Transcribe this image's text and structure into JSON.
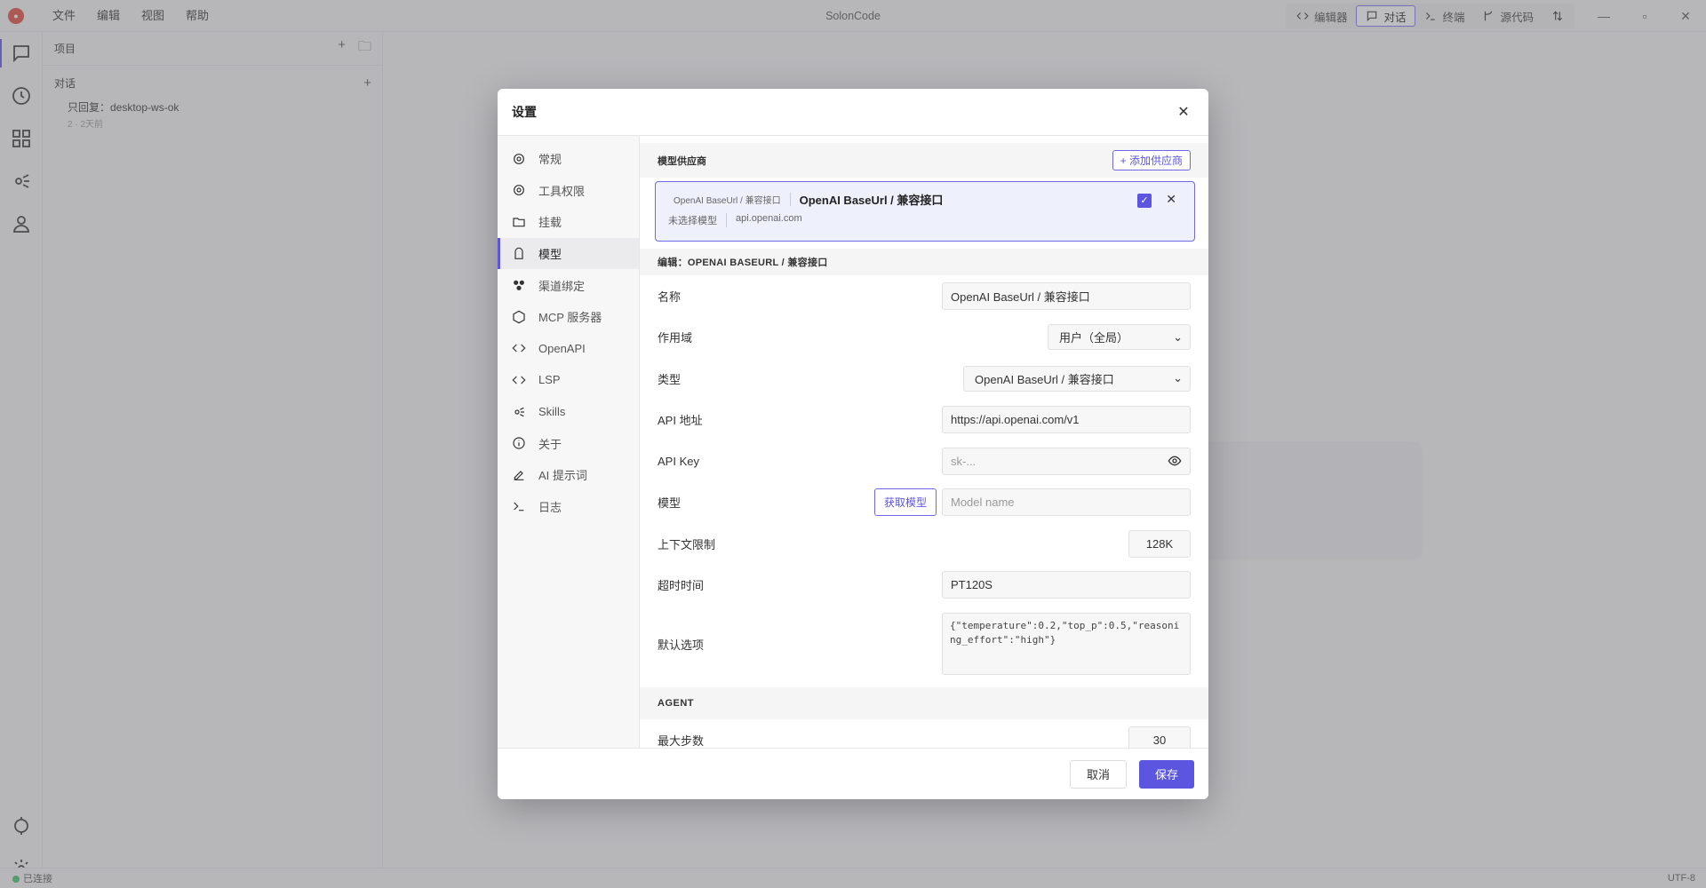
{
  "app": {
    "title": "SolonCode",
    "menu": [
      "文件",
      "编辑",
      "视图",
      "帮助"
    ],
    "mode_tabs": [
      {
        "label": "编辑器",
        "icon": "code-icon"
      },
      {
        "label": "对话",
        "icon": "chat-icon",
        "active": true
      },
      {
        "label": "终端",
        "icon": "terminal-icon"
      },
      {
        "label": "源代码",
        "icon": "git-branch-icon"
      }
    ]
  },
  "sidebar": {
    "project_label": "项目",
    "conversations_label": "对话",
    "conversation": {
      "title": "只回复：desktop-ws-ok",
      "meta": "2 · 2天前"
    }
  },
  "status": {
    "connection": "已连接",
    "encoding": "UTF-8"
  },
  "dialog": {
    "title": "设置",
    "nav": [
      {
        "label": "常规",
        "icon": "gear-icon"
      },
      {
        "label": "工具权限",
        "icon": "gear-icon"
      },
      {
        "label": "挂载",
        "icon": "folder-icon"
      },
      {
        "label": "模型",
        "icon": "model-icon",
        "active": true
      },
      {
        "label": "渠道绑定",
        "icon": "channel-icon"
      },
      {
        "label": "MCP 服务器",
        "icon": "hexagon-icon"
      },
      {
        "label": "OpenAPI",
        "icon": "code-icon"
      },
      {
        "label": "LSP",
        "icon": "code-icon"
      },
      {
        "label": "Skills",
        "icon": "skills-icon"
      },
      {
        "label": "关于",
        "icon": "info-icon"
      },
      {
        "label": "AI 提示词",
        "icon": "edit-icon"
      },
      {
        "label": "日志",
        "icon": "terminal-icon"
      }
    ],
    "providers_header": "模型供应商",
    "add_provider": "+ 添加供应商",
    "provider": {
      "tag": "OpenAI BaseUrl / 兼容接口",
      "name": "OpenAI BaseUrl / 兼容接口",
      "model_status": "未选择模型",
      "host": "api.openai.com",
      "enabled": true
    },
    "edit_header": "编辑：OPENAI BASEURL / 兼容接口",
    "form": {
      "name_label": "名称",
      "name_value": "OpenAI BaseUrl / 兼容接口",
      "scope_label": "作用域",
      "scope_value": "用户（全局）",
      "type_label": "类型",
      "type_value": "OpenAI BaseUrl / 兼容接口",
      "api_url_label": "API 地址",
      "api_url_value": "https://api.openai.com/v1",
      "api_key_label": "API Key",
      "api_key_placeholder": "sk-...",
      "model_label": "模型",
      "fetch_models": "获取模型",
      "model_placeholder": "Model name",
      "context_label": "上下文限制",
      "context_value": "128K",
      "timeout_label": "超时时间",
      "timeout_value": "PT120S",
      "options_label": "默认选项",
      "options_value": "{\"temperature\":0.2,\"top_p\":0.5,\"reasoning_effort\":\"high\"}"
    },
    "agent_header": "AGENT",
    "agent": {
      "max_steps_label": "最大步数",
      "max_steps_value": "30"
    },
    "cancel": "取消",
    "save": "保存"
  }
}
